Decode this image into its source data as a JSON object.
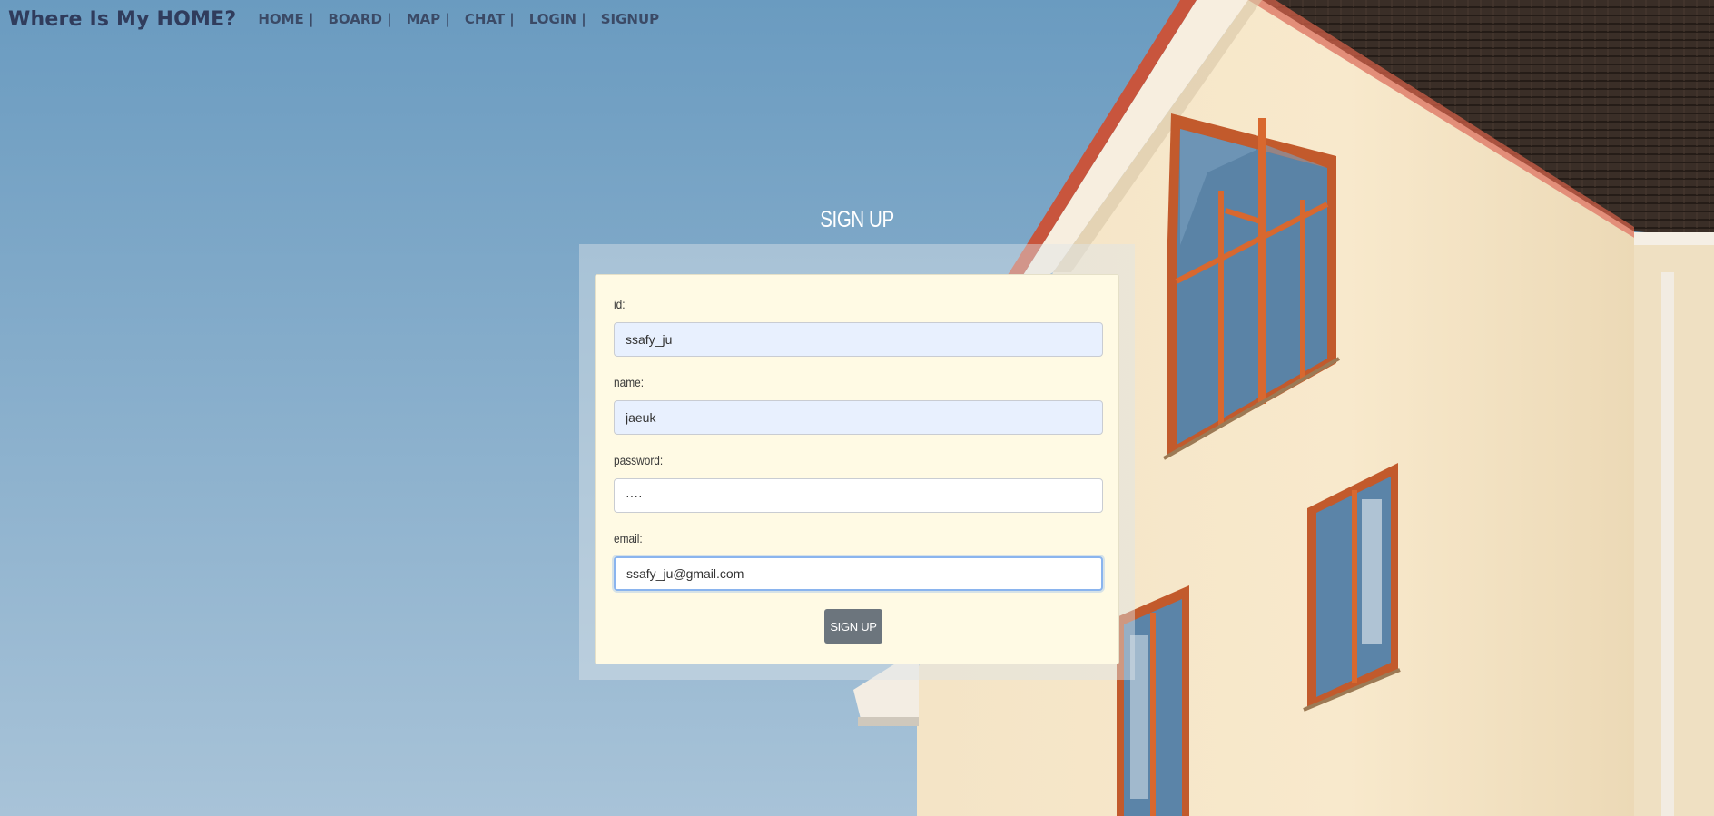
{
  "brand": "Where Is My HOME?",
  "nav": [
    {
      "label": "HOME |"
    },
    {
      "label": "BOARD |"
    },
    {
      "label": "MAP |"
    },
    {
      "label": "CHAT |"
    },
    {
      "label": "LOGIN |"
    },
    {
      "label": "SIGNUP"
    }
  ],
  "signup": {
    "title": "SIGN UP",
    "fields": [
      {
        "label": "id:",
        "value": "ssafy_ju"
      },
      {
        "label": "name:",
        "value": "jaeuk"
      },
      {
        "label": "password:",
        "value": "····"
      },
      {
        "label": "email:",
        "value": "ssafy_ju@gmail.com"
      }
    ],
    "button_label": "SIGN UP"
  },
  "colors": {
    "brand": "#303c5c",
    "sky": "#7ea7c7",
    "card": "#fffae4",
    "button": "#6c757d",
    "focus_ring": "#8ab4ee"
  }
}
